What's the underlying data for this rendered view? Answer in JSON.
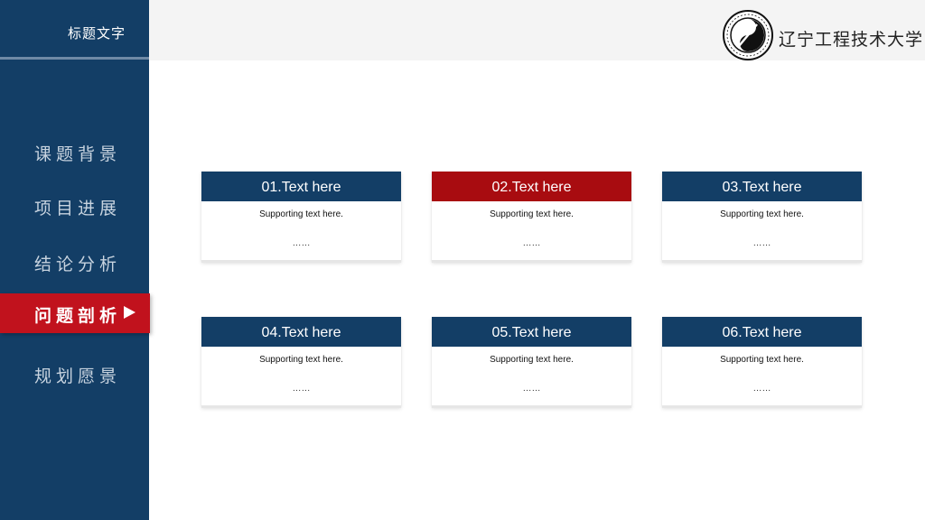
{
  "sidebar": {
    "title": "标题文字",
    "items": [
      {
        "label": "课题背景",
        "active": false
      },
      {
        "label": "项目进展",
        "active": false
      },
      {
        "label": "结论分析",
        "active": false
      },
      {
        "label": "问题剖析",
        "active": true
      },
      {
        "label": "规划愿景",
        "active": false
      }
    ]
  },
  "header": {
    "university_name": "辽宁工程技术大学",
    "logo_icon": "university-seal-icon"
  },
  "cards": [
    {
      "title": "01.Text here",
      "subtitle": "Supporting text here.",
      "ellipsis": "……",
      "highlight": false
    },
    {
      "title": "02.Text here",
      "subtitle": "Supporting text here.",
      "ellipsis": "……",
      "highlight": true
    },
    {
      "title": "03.Text here",
      "subtitle": "Supporting text here.",
      "ellipsis": "……",
      "highlight": false
    },
    {
      "title": "04.Text here",
      "subtitle": "Supporting text here.",
      "ellipsis": "……",
      "highlight": false
    },
    {
      "title": "05.Text here",
      "subtitle": "Supporting text here.",
      "ellipsis": "……",
      "highlight": false
    },
    {
      "title": "06.Text here",
      "subtitle": "Supporting text here.",
      "ellipsis": "……",
      "highlight": false
    }
  ],
  "colors": {
    "navy": "#133e66",
    "active_red": "#c1121d",
    "card_red": "#a80c10"
  }
}
